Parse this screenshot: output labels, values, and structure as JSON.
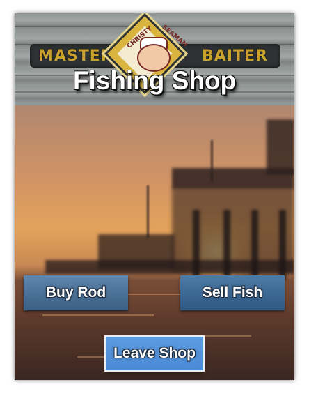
{
  "header": {
    "title": "Fishing Shop",
    "sign_left": "MASTER",
    "sign_right": "BAITER",
    "logo_top_text": "CHRISTY",
    "logo_right_text": "SEAMAN",
    "logo_icon": "sailor-face-icon"
  },
  "buttons": {
    "buy_rod": "Buy Rod",
    "sell_fish": "Sell Fish",
    "leave_shop": "Leave Shop"
  },
  "colors": {
    "button_blue": "#4a7096",
    "leave_button_blue": "#4a8ad6",
    "title_text": "#ffffff"
  }
}
